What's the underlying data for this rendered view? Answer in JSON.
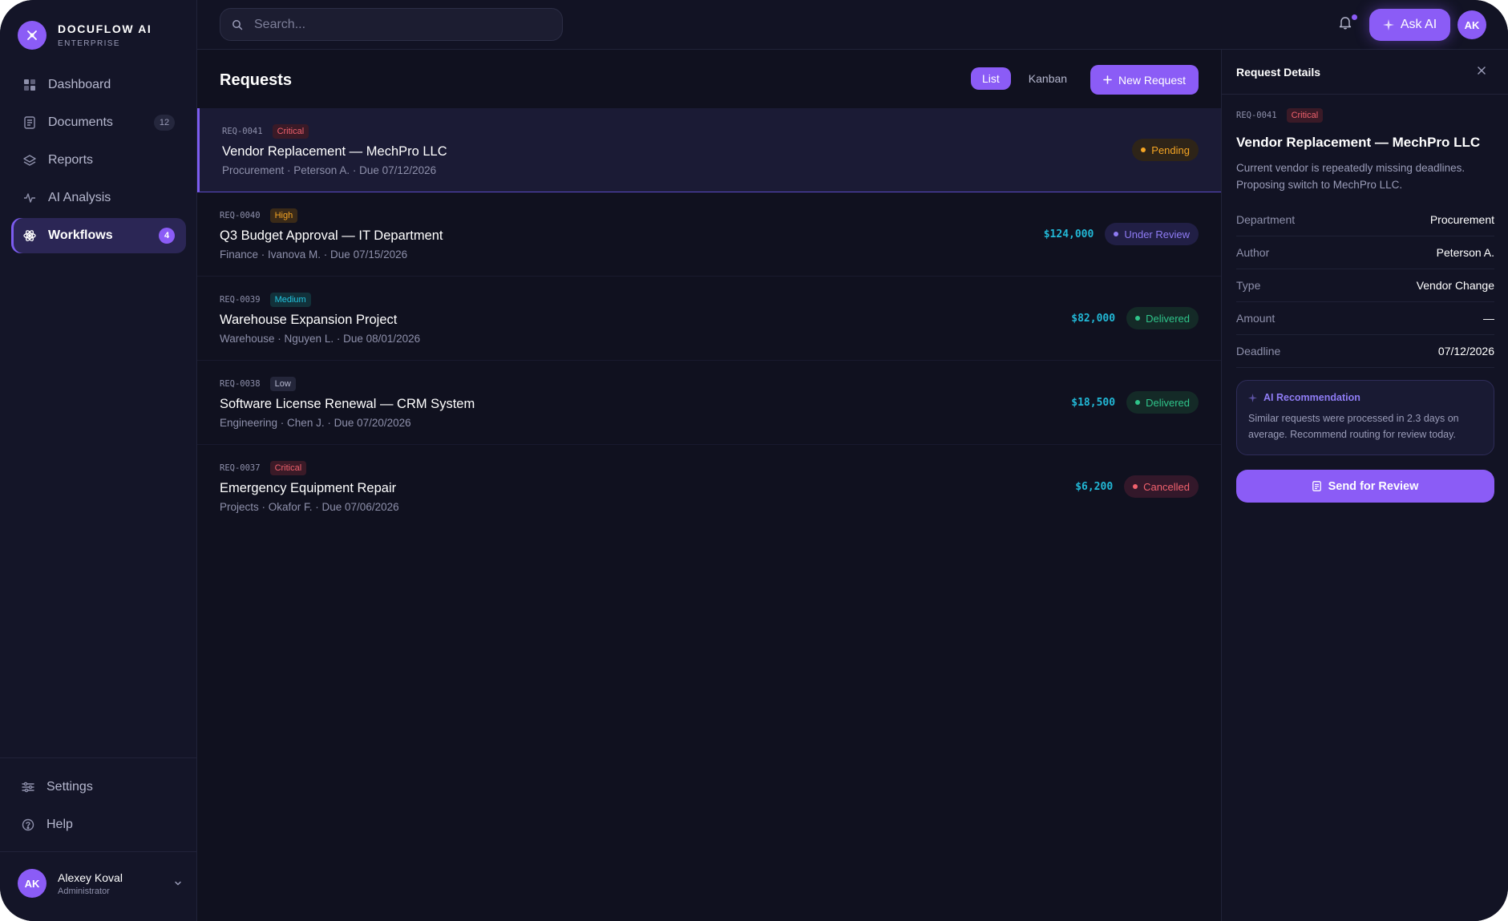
{
  "brand": {
    "name": "DOCUFLOW AI",
    "edition": "ENTERPRISE"
  },
  "sidebar": {
    "items": [
      {
        "label": "Dashboard",
        "icon": "grid-icon"
      },
      {
        "label": "Documents",
        "icon": "document-icon",
        "badge": "12"
      },
      {
        "label": "Reports",
        "icon": "layers-icon"
      },
      {
        "label": "AI Analysis",
        "icon": "pulse-icon"
      },
      {
        "label": "Workflows",
        "icon": "atom-icon",
        "badge": "4",
        "active": true
      }
    ],
    "bottom": [
      {
        "label": "Settings",
        "icon": "sliders-icon"
      },
      {
        "label": "Help",
        "icon": "help-circle-icon"
      }
    ],
    "user": {
      "initials": "AK",
      "name": "Alexey Koval",
      "role": "Administrator"
    }
  },
  "topbar": {
    "search_placeholder": "Search...",
    "ask_ai_label": "Ask AI",
    "avatar_initials": "AK"
  },
  "main": {
    "title": "Requests",
    "views": [
      "List",
      "Kanban"
    ],
    "active_view": "List",
    "new_request_label": "New Request",
    "requests": [
      {
        "id": "REQ-0041",
        "priority": "Critical",
        "title": "Vendor Replacement — MechPro LLC",
        "subtitle": "Procurement · Peterson A. · Due 07/12/2026",
        "amount": "",
        "status": "Pending",
        "selected": true
      },
      {
        "id": "REQ-0040",
        "priority": "High",
        "title": "Q3 Budget Approval — IT Department",
        "subtitle": "Finance · Ivanova M. · Due 07/15/2026",
        "amount": "$124,000",
        "status": "Under Review"
      },
      {
        "id": "REQ-0039",
        "priority": "Medium",
        "title": "Warehouse Expansion Project",
        "subtitle": "Warehouse · Nguyen L. · Due 08/01/2026",
        "amount": "$82,000",
        "status": "Delivered"
      },
      {
        "id": "REQ-0038",
        "priority": "Low",
        "title": "Software License Renewal — CRM System",
        "subtitle": "Engineering · Chen J. · Due 07/20/2026",
        "amount": "$18,500",
        "status": "Delivered"
      },
      {
        "id": "REQ-0037",
        "priority": "Critical",
        "title": "Emergency Equipment Repair",
        "subtitle": "Projects · Okafor F. · Due 07/06/2026",
        "amount": "$6,200",
        "status": "Cancelled"
      }
    ]
  },
  "details": {
    "header": "Request Details",
    "id": "REQ-0041",
    "priority": "Critical",
    "title": "Vendor Replacement — MechPro LLC",
    "description": "Current vendor is repeatedly missing deadlines. Proposing switch to MechPro LLC.",
    "fields": [
      {
        "key": "Department",
        "value": "Procurement"
      },
      {
        "key": "Author",
        "value": "Peterson A."
      },
      {
        "key": "Type",
        "value": "Vendor Change"
      },
      {
        "key": "Amount",
        "value": "—"
      },
      {
        "key": "Deadline",
        "value": "07/12/2026"
      }
    ],
    "ai_title": "AI Recommendation",
    "ai_text": "Similar requests were processed in 2.3 days on average. Recommend routing for review today.",
    "send_label": "Send for Review"
  },
  "colors": {
    "accent": "#8b5cf6",
    "background": "#10111f",
    "sidebar": "#141528"
  }
}
